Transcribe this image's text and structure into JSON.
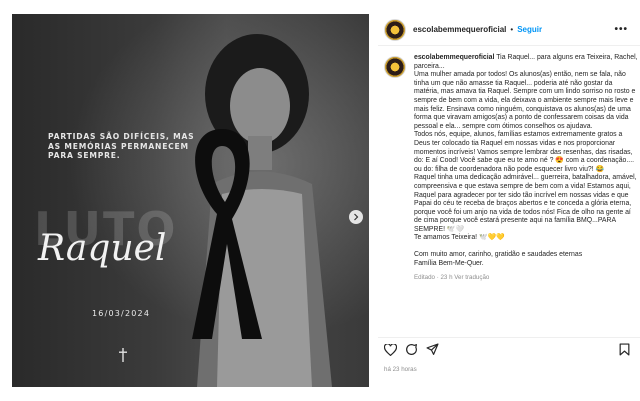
{
  "post": {
    "username": "escolabemmequeroficial",
    "follow_label": "Seguir",
    "separator": "•",
    "more_label": "•••",
    "time_ago": "há 23 horas"
  },
  "media": {
    "tagline": "PARTIDAS SÃO DIFÍCEIS, MAS AS MEMÓRIAS PERMANECEM PARA SEMPRE.",
    "watermark": "LUTO",
    "name": "Raquel",
    "date": "16/03/2024"
  },
  "caption": {
    "username": "escolabemmequeroficial",
    "lines": [
      "Tia Raquel... para alguns era Teixeira, Rachel, parceira...",
      "Uma mulher amada por todos! Os alunos(as) então, nem se fala, não tinha um que não amasse tia Raquel... poderia até não gostar da matéria, mas amava tia Raquel. Sempre com um lindo sorriso no rosto e sempre de bem com a vida, ela deixava o ambiente sempre mais leve e mais feliz. Ensinava como ninguém, conquistava os alunos(as) de uma forma que viravam amigos(as) a ponto de confessarem coisas da vida pessoal e ela... sempre com ótimos conselhos os ajudava.",
      "Todos nós, equipe, alunos, famílias estamos extremamente gratos a Deus ter colocado tia Raquel em nossas vidas e nos proporcionar momentos incríveis! Vamos sempre lembrar das resenhas, das risadas, do: E aí Cood! Você sabe que eu te amo né ? 😍 com a coordenação.... ou do: filha de coordenadora não pode esquecer livro viu?! 😂",
      "Raquel tinha uma dedicação admirável... guerreira, batalhadora, amável, compreensiva e que estava sempre de bem com a vida! Estamos aqui, Raquel para agradecer por ter sido tão incrível em nossas vidas e que Papai do céu te receba de braços abertos e te conceda a glória eterna, porque você foi um anjo na vida de todos nós! Fica de olho na gente aí de cima porque você estará presente aqui na família BMQ...PARA SEMPRE! 🕊️🤍",
      "Te amamos Teixeira! 🕊️💛💛",
      "",
      "Com muito amor, carinho, gratidão e saudades eternas",
      "Família Bem-Me-Quer."
    ],
    "meta": "Editado · 23 h   Ver tradução"
  },
  "icons": {
    "like": "heart-icon",
    "comment": "comment-icon",
    "share": "share-icon",
    "save": "bookmark-icon",
    "next": "chevron-right-icon"
  }
}
